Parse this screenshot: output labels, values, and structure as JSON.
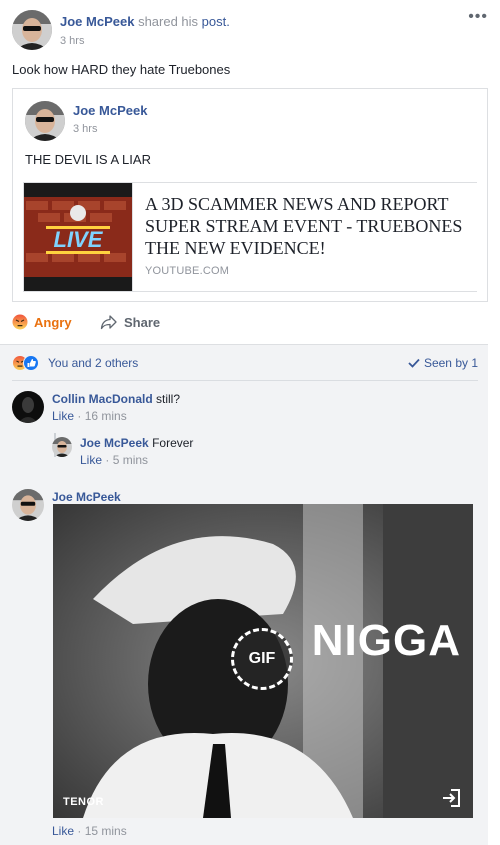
{
  "post": {
    "author": "Joe McPeek",
    "shared_text": "shared his",
    "post_link": "post.",
    "time": "3 hrs",
    "text": "Look how HARD they hate Truebones",
    "more_label": "•••"
  },
  "shared": {
    "author": "Joe McPeek",
    "time": "3 hrs",
    "text": "THE DEVIL IS A LIAR",
    "link_title": "A 3D SCAMMER NEWS AND REPORT SUPER STREAM EVENT - TRUEBONES THE NEW EVIDENCE!",
    "link_domain": "YOUTUBE.COM",
    "thumb_badge": "LIVE"
  },
  "actions": {
    "angry": "Angry",
    "share": "Share"
  },
  "reactions": {
    "text": "You and 2 others",
    "seen": "Seen by 1"
  },
  "comments": [
    {
      "author": "Collin MacDonald",
      "text": "still?",
      "like": "Like",
      "time": "16 mins"
    },
    {
      "author": "Joe McPeek",
      "text": "Forever",
      "like": "Like",
      "time": "5 mins"
    },
    {
      "author": "Joe McPeek",
      "text": "",
      "like": "Like",
      "time": "15 mins"
    }
  ],
  "gif": {
    "overlay_text": "NIGGA",
    "badge": "GIF",
    "provider": "TENOR"
  },
  "colors": {
    "link": "#385898",
    "angry": "#e9710f",
    "muted": "#90949c",
    "comments_bg": "#f2f3f5"
  }
}
